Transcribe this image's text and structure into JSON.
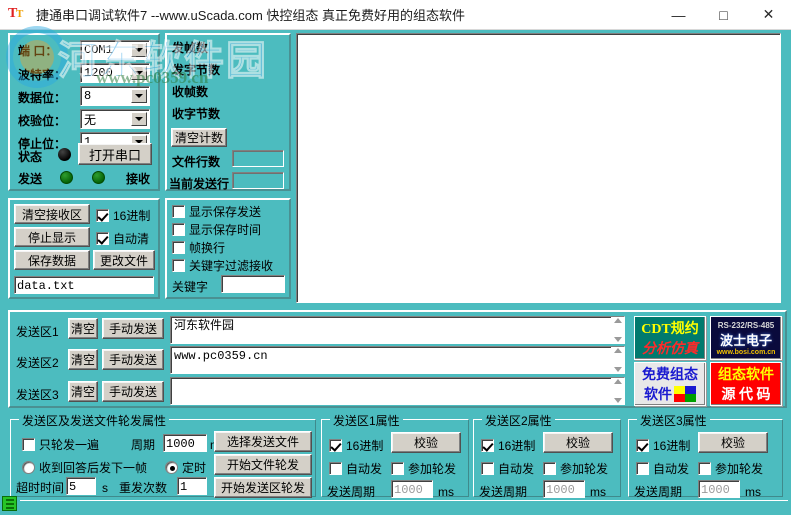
{
  "window": {
    "title": "捷通串口调试软件7  --www.uScada.com   快控组态  真正免费好用的组态软件",
    "icon": "app-icon",
    "minimize": "—",
    "maximize": "□",
    "close": "✕"
  },
  "watermark": {
    "text": "河东软件园",
    "url": "www.pc0359.cn"
  },
  "serial": {
    "labels": {
      "port": "端  口：",
      "baud": "波特率：",
      "data_bits": "数据位：",
      "parity": "校验位：",
      "stop_bits": "停止位：",
      "status": "状态",
      "send": "发送",
      "receive": "接收"
    },
    "port": "COM1",
    "baud": "1200",
    "data_bits": "8",
    "parity": "无",
    "stop_bits": "1",
    "open_button": "打开串口"
  },
  "counters": {
    "tx_frames": "发帧数",
    "tx_bytes": "发字节数",
    "rx_frames": "收帧数",
    "rx_bytes": "收字节数",
    "clear_button": "清空计数",
    "file_lines_label": "文件行数",
    "file_lines_value": "",
    "current_line_label": "当前发送行",
    "current_line_value": ""
  },
  "recv_controls": {
    "clear_recv": "清空接收区",
    "stop_display": "停止显示",
    "save_data": "保存数据",
    "change_file": "更改文件",
    "hex_label": "16进制",
    "hex_checked": true,
    "autoclear_label": "自动清",
    "autoclear_checked": true,
    "filename": "data.txt"
  },
  "display_options": {
    "show_save_send": "显示保存发送",
    "show_save_time": "显示保存时间",
    "frame_newline": "帧换行",
    "keyword_filter": "关键字过滤接收",
    "keyword_label": "关键字",
    "keyword_value": ""
  },
  "receive_area": {
    "content": ""
  },
  "send_areas": [
    {
      "label": "发送区1",
      "clear": "清空",
      "manual": "手动发送",
      "text": "河东软件园"
    },
    {
      "label": "发送区2",
      "clear": "清空",
      "manual": "手动发送",
      "text": "www.pc0359.cn"
    },
    {
      "label": "发送区3",
      "clear": "清空",
      "manual": "手动发送",
      "text": ""
    }
  ],
  "ads": [
    {
      "name": "cdt-protocol-ad",
      "line1": "CDT规约",
      "line2": "分析仿真",
      "bg": "#007a6e",
      "c1": "#ffff00",
      "c2": "#ff2a2a"
    },
    {
      "name": "bosi-electronics-ad",
      "line1": "RS-232/RS-485",
      "line2": "波士电子",
      "line3": "www.bosi.com.cn",
      "bg": "#0a0a3c",
      "c1": "#d0d0d0",
      "c2": "#ffffff",
      "c3": "#f0c000"
    },
    {
      "name": "free-scada-ad",
      "line1": "免费组态",
      "line2": "软件",
      "bg": "#e8e8e8",
      "c1": "#1a1ad0",
      "c2": "#1a1ad0"
    },
    {
      "name": "scada-source-ad",
      "line1": "组态软件",
      "line2": "源 代 码",
      "bg": "#ff0000",
      "c1": "#ffff00",
      "c2": "#ffffff"
    }
  ],
  "rotation_group": {
    "title": "发送区及发送文件轮发属性",
    "once_label": "只轮发一遍",
    "once_checked": false,
    "period_label": "周期",
    "period_value": "1000",
    "period_unit": "ms",
    "after_reply_label": "收到回答后发下一帧",
    "after_reply_selected": false,
    "timed_label": "定时",
    "timed_selected": true,
    "timeout_label": "超时时间",
    "timeout_value": "5",
    "timeout_unit": "s",
    "retry_label": "重发次数",
    "retry_value": "1",
    "select_file_button": "选择发送文件",
    "start_file_button": "开始文件轮发",
    "start_area_button": "开始发送区轮发"
  },
  "area_props": [
    {
      "title": "发送区1属性",
      "hex_label": "16进制",
      "hex_checked": true,
      "verify_button": "校验",
      "auto_label": "自动发",
      "auto_checked": false,
      "join_label": "参加轮发",
      "join_checked": false,
      "period_label": "发送周期",
      "period_value": "1000",
      "period_unit": "ms"
    },
    {
      "title": "发送区2属性",
      "hex_label": "16进制",
      "hex_checked": true,
      "verify_button": "校验",
      "auto_label": "自动发",
      "auto_checked": false,
      "join_label": "参加轮发",
      "join_checked": false,
      "period_label": "发送周期",
      "period_value": "1000",
      "period_unit": "ms"
    },
    {
      "title": "发送区3属性",
      "hex_label": "16进制",
      "hex_checked": true,
      "verify_button": "校验",
      "auto_label": "自动发",
      "auto_checked": false,
      "join_label": "参加轮发",
      "join_checked": false,
      "period_label": "发送周期",
      "period_value": "1000",
      "period_unit": "ms"
    }
  ],
  "theme": {
    "bg": "#4cbcbf",
    "button_face": "#d4d0c8",
    "field_bg": "#ffffff"
  }
}
